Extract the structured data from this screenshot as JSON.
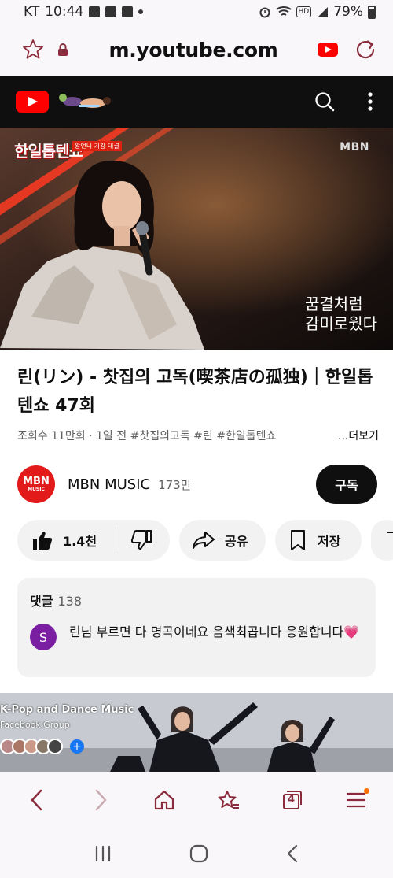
{
  "status_bar": {
    "carrier": "KT",
    "time": "10:44",
    "network_badge": "HD",
    "battery": "79%"
  },
  "browser": {
    "url": "m.youtube.com",
    "tab_count": "4"
  },
  "video": {
    "show_logo": "한일톱텐쇼",
    "show_tag": "왕언니 기강 대결",
    "broadcaster": "MBN",
    "caption_line1": "꿈결처럼",
    "caption_line2": "감미로웠다"
  },
  "title": "린(リン) - 찻집의 고독(喫茶店の孤独)｜한일톱텐쇼 47회",
  "meta": {
    "info": "조회수 11만회 · 1일 전  #찻집의고독 #린 #한일톱텐쇼",
    "more": "...더보기"
  },
  "channel": {
    "avatar_line1": "MBN",
    "avatar_line2": "MUSIC",
    "name": "MBN MUSIC",
    "subscribers": "173만",
    "subscribe_label": "구독"
  },
  "actions": {
    "like_count": "1.4천",
    "share_label": "공유",
    "save_label": "저장"
  },
  "comments": {
    "title": "댓글",
    "count": "138",
    "top": {
      "avatar_letter": "S",
      "text": "린님 부르면 다 명곡이네요 음색최곱니다 응원합니다",
      "emoji": "💗"
    }
  },
  "ad": {
    "title": "K-Pop and Dance Music",
    "subtitle": "Facebook Group"
  },
  "colors": {
    "youtube_red": "#ff0000",
    "browser_accent": "#8b2c3c",
    "comment_avatar": "#7b1fa2"
  }
}
